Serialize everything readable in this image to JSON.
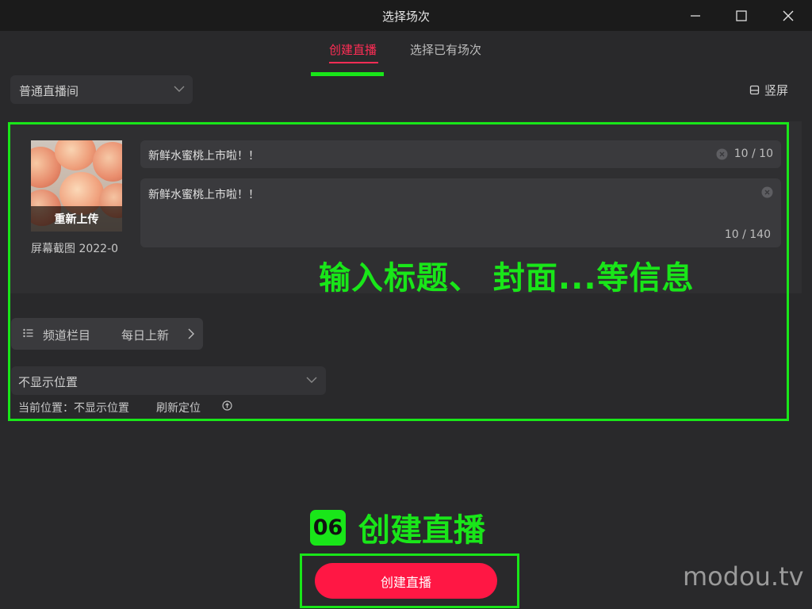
{
  "window": {
    "title": "选择场次"
  },
  "tabs": [
    {
      "label": "创建直播",
      "active": true
    },
    {
      "label": "选择已有场次",
      "active": false
    }
  ],
  "room_type": {
    "value": "普通直播间"
  },
  "orientation": {
    "label": "竖屏"
  },
  "cover": {
    "upload_label": "重新上传",
    "file_name": "屏幕截图 2022-0"
  },
  "title_field": {
    "value": "新鲜水蜜桃上市啦！！",
    "count": "10 / 10"
  },
  "desc_field": {
    "value": "新鲜水蜜桃上市啦！！",
    "count": "10 / 140"
  },
  "annotation_info": "输入标题、 封面...等信息",
  "channel": {
    "label": "频道栏目",
    "value": "每日上新"
  },
  "location": {
    "select_value": "不显示位置",
    "current": "当前位置：不显示位置",
    "refresh_label": "刷新定位"
  },
  "step": {
    "number": "06",
    "label": "创建直播"
  },
  "create_button": {
    "label": "创建直播"
  },
  "watermark": "modou.tv",
  "colors": {
    "accent": "#ff1744",
    "tab_active": "#ff2d55",
    "highlight": "#19e619",
    "background": "#29292b"
  }
}
